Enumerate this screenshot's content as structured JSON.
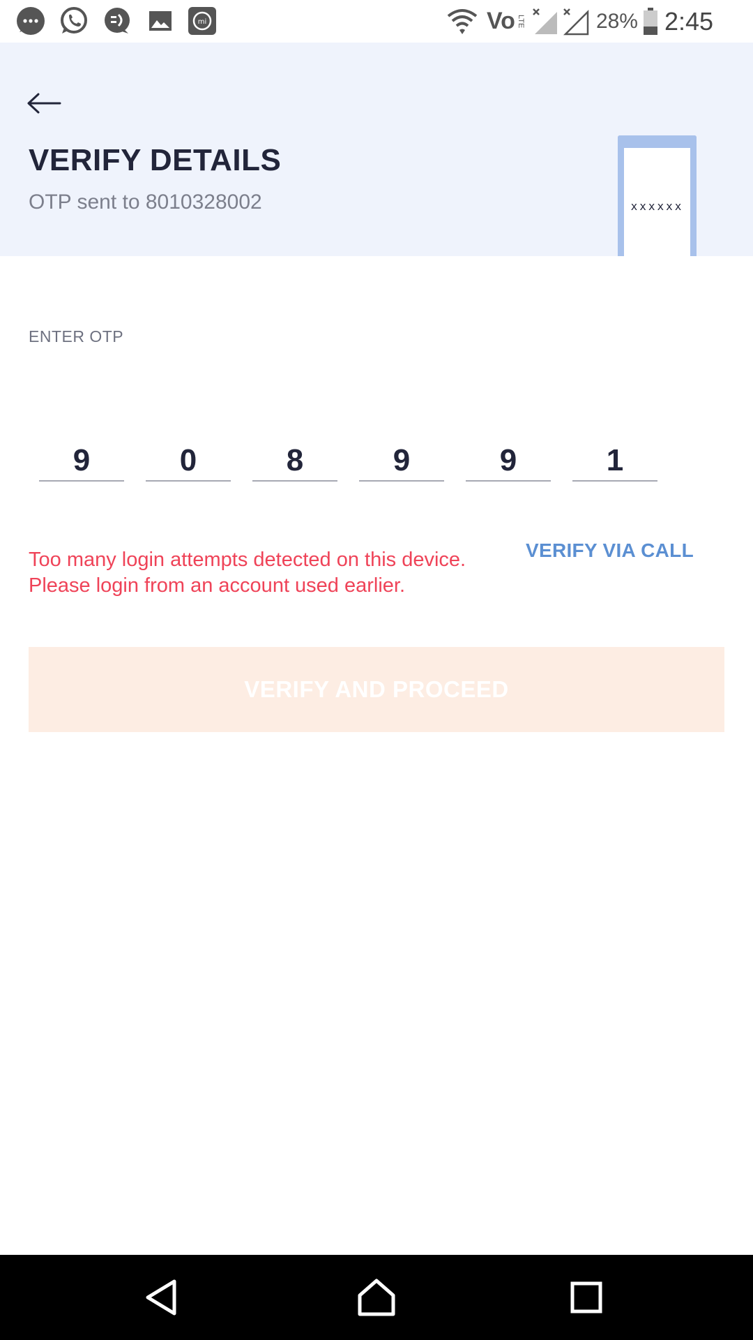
{
  "status_bar": {
    "battery": "28%",
    "time": "2:45",
    "network": "Vo",
    "network_sub": "LTE",
    "left_icons": [
      "messages-icon",
      "whatsapp-icon",
      "chat-icon",
      "gallery-icon",
      "mi-icon"
    ]
  },
  "header": {
    "back_label": "back",
    "title": "VERIFY DETAILS",
    "subtitle": "OTP sent to 8010328002",
    "illustration_text": "xxxxxx"
  },
  "otp": {
    "label": "ENTER OTP",
    "digits": [
      "9",
      "0",
      "8",
      "9",
      "9",
      "1"
    ]
  },
  "error_message": "Too many login attempts detected on this device. Please login from an account used earlier.",
  "verify_via_call": "VERIFY VIA CALL",
  "proceed_button": "VERIFY AND PROCEED",
  "colors": {
    "header_bg": "#eff3fc",
    "title": "#22253a",
    "error": "#ef4358",
    "link": "#5b8fd2",
    "button_disabled_bg": "#fdede3"
  }
}
